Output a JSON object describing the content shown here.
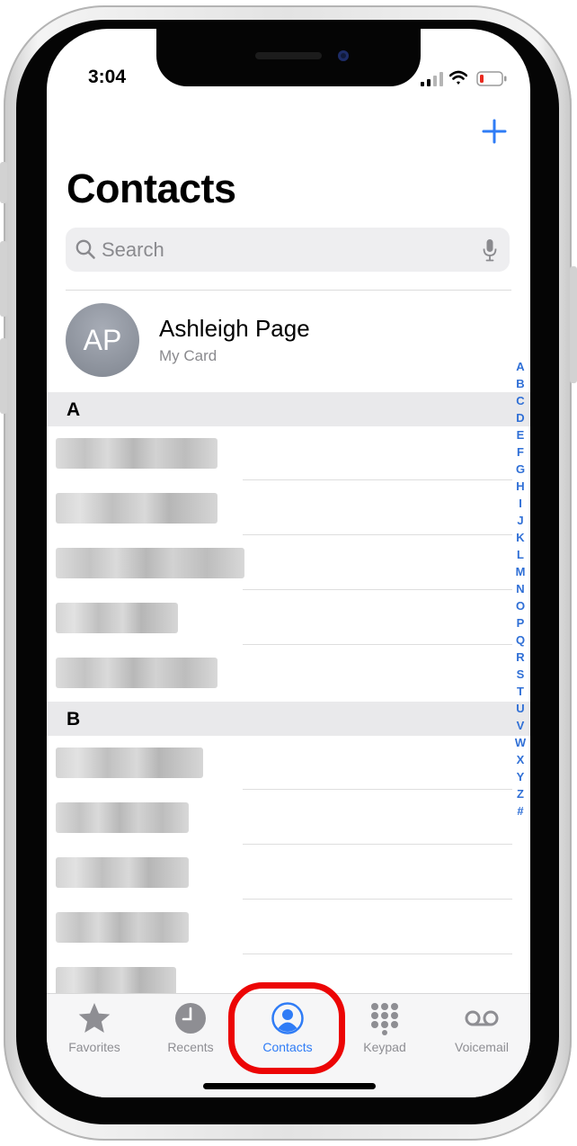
{
  "status_bar": {
    "time": "3:04"
  },
  "header": {
    "title": "Contacts",
    "add_icon": "plus-icon"
  },
  "search": {
    "placeholder": "Search",
    "value": ""
  },
  "my_card": {
    "initials": "AP",
    "name": "Ashleigh Page",
    "subtitle": "My Card"
  },
  "sections": [
    {
      "letter": "A",
      "contacts_count_visible": 5
    },
    {
      "letter": "B",
      "contacts_count_visible": 5
    }
  ],
  "index_letters": [
    "A",
    "B",
    "C",
    "D",
    "E",
    "F",
    "G",
    "H",
    "I",
    "J",
    "K",
    "L",
    "M",
    "N",
    "O",
    "P",
    "Q",
    "R",
    "S",
    "T",
    "U",
    "V",
    "W",
    "X",
    "Y",
    "Z",
    "#"
  ],
  "tabs": [
    {
      "label": "Favorites",
      "icon": "star-icon",
      "active": false
    },
    {
      "label": "Recents",
      "icon": "clock-icon",
      "active": false
    },
    {
      "label": "Contacts",
      "icon": "person-circle-icon",
      "active": true
    },
    {
      "label": "Keypad",
      "icon": "keypad-icon",
      "active": false
    },
    {
      "label": "Voicemail",
      "icon": "voicemail-icon",
      "active": false
    }
  ],
  "colors": {
    "accent": "#2f7cf6",
    "highlight": "#ec0505",
    "index": "#2f6fd6"
  }
}
